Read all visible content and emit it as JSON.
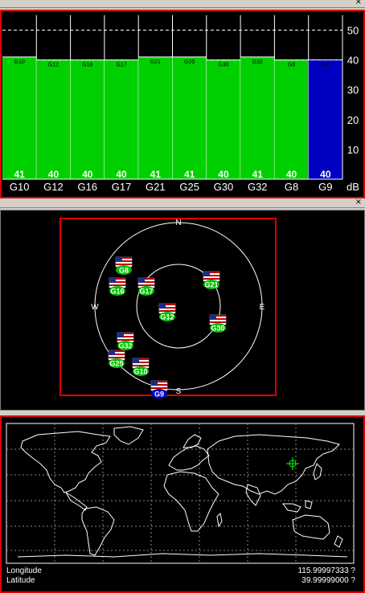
{
  "snr": {
    "unit": "dB",
    "y_ticks": [
      "50",
      "40",
      "30",
      "20",
      "10"
    ],
    "satellites": [
      {
        "prn": "G10",
        "snr": 41,
        "top": "G10",
        "color": "#00d000"
      },
      {
        "prn": "G12",
        "snr": 40,
        "top": "G12",
        "color": "#00d000"
      },
      {
        "prn": "G16",
        "snr": 40,
        "top": "G16",
        "color": "#00d000"
      },
      {
        "prn": "G17",
        "snr": 40,
        "top": "G17",
        "color": "#00d000"
      },
      {
        "prn": "G21",
        "snr": 41,
        "top": "G21",
        "color": "#00d000"
      },
      {
        "prn": "G25",
        "snr": 41,
        "top": "G25",
        "color": "#00d000"
      },
      {
        "prn": "G30",
        "snr": 40,
        "top": "G30",
        "color": "#00d000"
      },
      {
        "prn": "G32",
        "snr": 41,
        "top": "G32",
        "color": "#00d000"
      },
      {
        "prn": "G8",
        "snr": 40,
        "top": "G8",
        "color": "#00d000"
      },
      {
        "prn": "G9",
        "snr": 40,
        "top": "G9",
        "color": "#0000c0"
      }
    ]
  },
  "sky": {
    "compass": {
      "n": "N",
      "e": "E",
      "s": "S",
      "w": "W"
    },
    "satellites": [
      {
        "prn": "G8",
        "color": "#00c000"
      },
      {
        "prn": "G16",
        "color": "#00c000"
      },
      {
        "prn": "G17",
        "color": "#00c000"
      },
      {
        "prn": "G21",
        "color": "#00c000"
      },
      {
        "prn": "G12",
        "color": "#00c000"
      },
      {
        "prn": "G30",
        "color": "#00c000"
      },
      {
        "prn": "G32",
        "color": "#00c000"
      },
      {
        "prn": "G25",
        "color": "#00c000"
      },
      {
        "prn": "G10",
        "color": "#00c000"
      },
      {
        "prn": "G9",
        "color": "#0000d0"
      }
    ]
  },
  "map": {
    "longitude_label": "Longitude",
    "longitude_value": "115.99997333 ?",
    "latitude_label": "Latitude",
    "latitude_value": "39.99999000 ?"
  },
  "colors": {
    "frame": "#e00000",
    "grid": "#ffffff",
    "bar": "#00d000",
    "selected": "#0000c0"
  }
}
